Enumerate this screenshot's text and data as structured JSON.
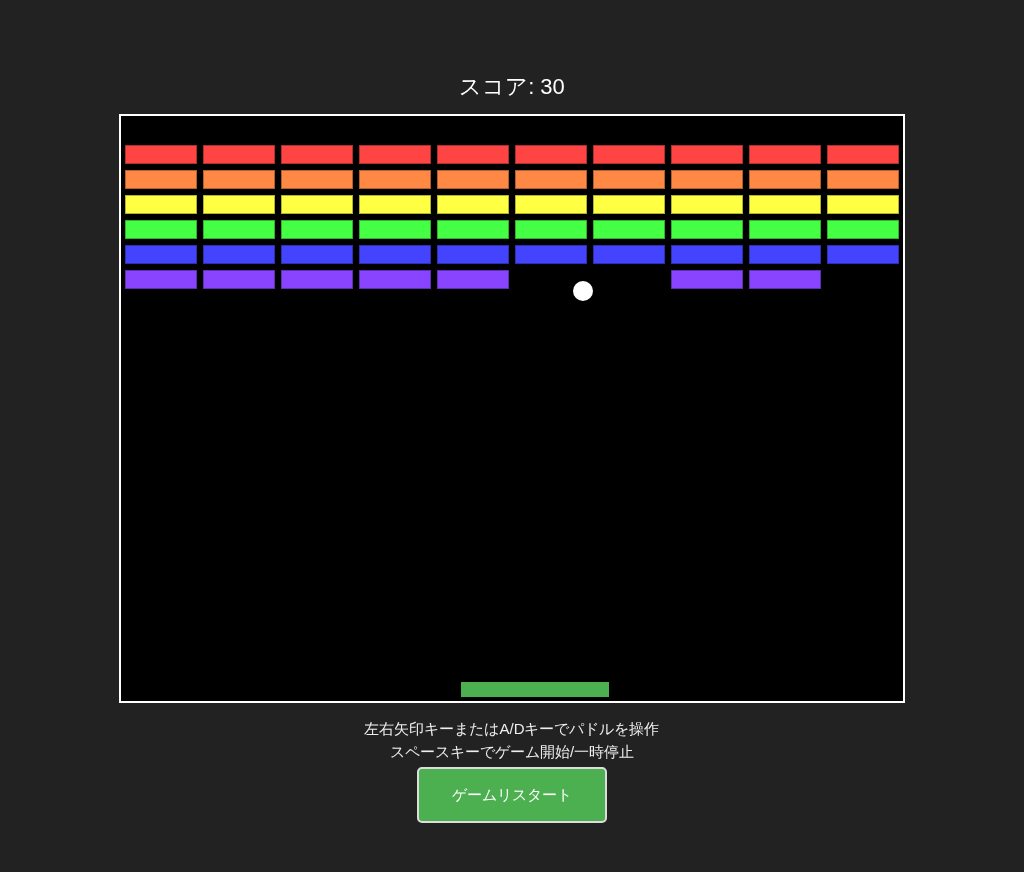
{
  "score": "スコア: 30",
  "brick_rows": [
    {
      "color": "#ff4444",
      "bricks": [
        true,
        true,
        true,
        true,
        true,
        true,
        true,
        true,
        true,
        true
      ]
    },
    {
      "color": "#ff8844",
      "bricks": [
        true,
        true,
        true,
        true,
        true,
        true,
        true,
        true,
        true,
        true
      ]
    },
    {
      "color": "#ffff44",
      "bricks": [
        true,
        true,
        true,
        true,
        true,
        true,
        true,
        true,
        true,
        true
      ]
    },
    {
      "color": "#44ff44",
      "bricks": [
        true,
        true,
        true,
        true,
        true,
        true,
        true,
        true,
        true,
        true
      ]
    },
    {
      "color": "#4444ff",
      "bricks": [
        true,
        true,
        true,
        true,
        true,
        true,
        true,
        true,
        true,
        true
      ]
    },
    {
      "color": "#8844ff",
      "bricks": [
        true,
        true,
        true,
        true,
        true,
        false,
        false,
        true,
        true,
        false
      ]
    }
  ],
  "instructions": [
    "左右矢印キーまたはA/Dキーでパドルを操作",
    "スペースキーでゲーム開始/一時停止"
  ],
  "restart_button": "ゲームリスタート"
}
